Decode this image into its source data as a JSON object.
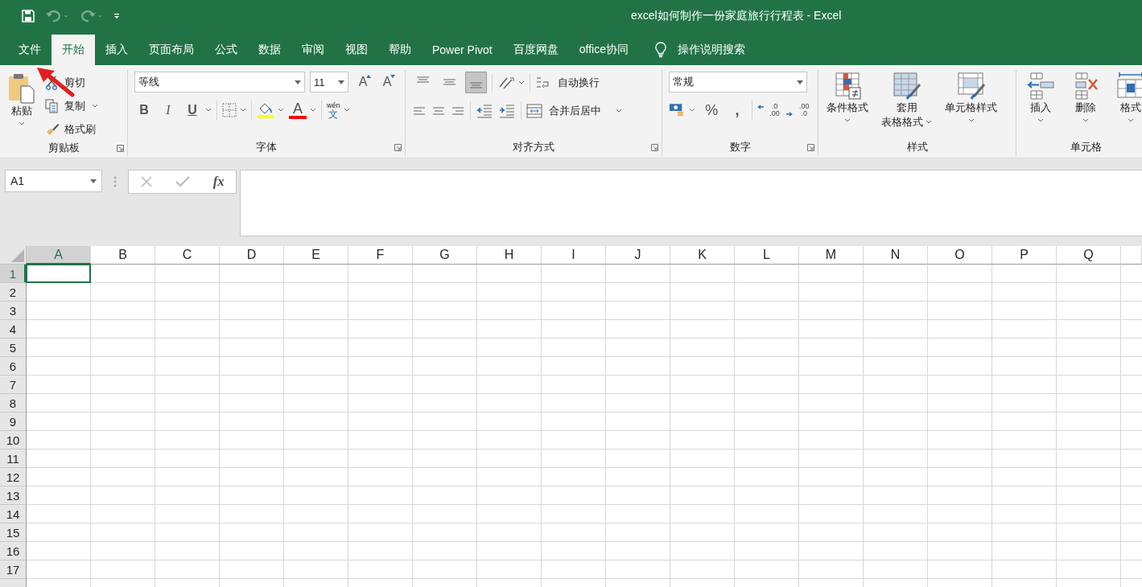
{
  "window": {
    "title": "excel如何制作一份家庭旅行行程表  -  Excel"
  },
  "tabs": [
    {
      "label": "文件",
      "selected": false
    },
    {
      "label": "开始",
      "selected": true
    },
    {
      "label": "插入",
      "selected": false
    },
    {
      "label": "页面布局",
      "selected": false
    },
    {
      "label": "公式",
      "selected": false
    },
    {
      "label": "数据",
      "selected": false
    },
    {
      "label": "审阅",
      "selected": false
    },
    {
      "label": "视图",
      "selected": false
    },
    {
      "label": "帮助",
      "selected": false
    },
    {
      "label": "Power Pivot",
      "selected": false
    },
    {
      "label": "百度网盘",
      "selected": false
    },
    {
      "label": "office协同",
      "selected": false
    }
  ],
  "tell_me": {
    "placeholder": "操作说明搜索"
  },
  "clipboard": {
    "paste": "粘贴",
    "cut": "剪切",
    "copy": "复制",
    "format_painter": "格式刷",
    "label": "剪贴板"
  },
  "font": {
    "name": "等线",
    "size": "11",
    "grow": "A",
    "shrink": "A",
    "styles": [
      "B",
      "I",
      "U"
    ],
    "font_color": "A",
    "phonetic": [
      "wén",
      "文"
    ],
    "label": "字体"
  },
  "alignment": {
    "vertical": [
      {
        "selected": false
      },
      {
        "selected": false
      },
      {
        "selected": true
      }
    ],
    "wrap_text": "自动换行",
    "merge_center": "合并后居中",
    "label": "对齐方式"
  },
  "number": {
    "format": "常规",
    "percent": "%",
    "comma": ",",
    "decimals": [
      [
        ".0",
        ".00"
      ],
      [
        ".00",
        ".0"
      ]
    ],
    "label": "数字"
  },
  "styles": {
    "conditional": "条件格式",
    "table_format": [
      "套用",
      "表格格式"
    ],
    "cell_styles": "单元格样式",
    "label": "样式"
  },
  "cells": {
    "insert": "插入",
    "delete": "删除",
    "format": "格式",
    "label": "单元格"
  },
  "formula_bar": {
    "name_box": "A1",
    "fx": "fx"
  },
  "sheet": {
    "columns": [
      {
        "label": "A",
        "selected": true
      },
      {
        "label": "B",
        "selected": false
      },
      {
        "label": "C",
        "selected": false
      },
      {
        "label": "D",
        "selected": false
      },
      {
        "label": "E",
        "selected": false
      },
      {
        "label": "F",
        "selected": false
      },
      {
        "label": "G",
        "selected": false
      },
      {
        "label": "H",
        "selected": false
      },
      {
        "label": "I",
        "selected": false
      },
      {
        "label": "J",
        "selected": false
      },
      {
        "label": "K",
        "selected": false
      },
      {
        "label": "L",
        "selected": false
      },
      {
        "label": "M",
        "selected": false
      },
      {
        "label": "N",
        "selected": false
      },
      {
        "label": "O",
        "selected": false
      },
      {
        "label": "P",
        "selected": false
      },
      {
        "label": "Q",
        "selected": false
      }
    ],
    "rows": [
      {
        "label": "1",
        "selected": true
      },
      {
        "label": "2",
        "selected": false
      },
      {
        "label": "3",
        "selected": false
      },
      {
        "label": "4",
        "selected": false
      },
      {
        "label": "5",
        "selected": false
      },
      {
        "label": "6",
        "selected": false
      },
      {
        "label": "7",
        "selected": false
      },
      {
        "label": "8",
        "selected": false
      },
      {
        "label": "9",
        "selected": false
      },
      {
        "label": "10",
        "selected": false
      },
      {
        "label": "11",
        "selected": false
      },
      {
        "label": "12",
        "selected": false
      },
      {
        "label": "13",
        "selected": false
      },
      {
        "label": "14",
        "selected": false
      },
      {
        "label": "15",
        "selected": false
      },
      {
        "label": "16",
        "selected": false
      },
      {
        "label": "17",
        "selected": false
      }
    ]
  }
}
